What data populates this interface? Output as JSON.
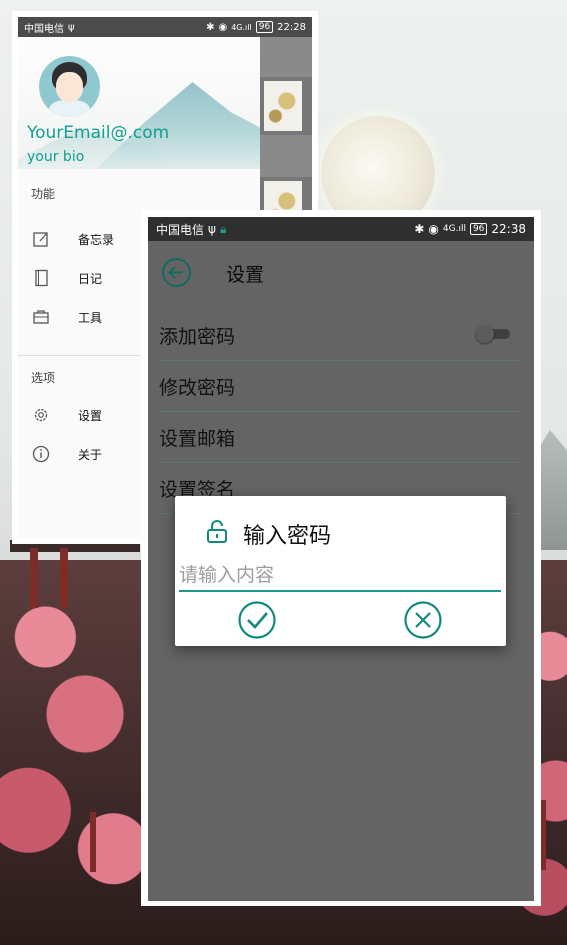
{
  "colors": {
    "accent": "#11a08f",
    "dim_overlay": "#646464",
    "dialog_bg": "#ffffff"
  },
  "drawer_screen": {
    "status": {
      "carrier": "中国电信",
      "usb": "ψ",
      "signal": "4G.ıll",
      "battery": "96",
      "time": "22:28"
    },
    "header": {
      "email": "YourEmail@.com",
      "bio": "your bio"
    },
    "groups": [
      {
        "title": "功能",
        "items": [
          {
            "label": "备忘录",
            "icon": "memo-edit-icon"
          },
          {
            "label": "日记",
            "icon": "diary-book-icon"
          },
          {
            "label": "工具",
            "icon": "toolbox-icon"
          }
        ]
      },
      {
        "title": "选项",
        "items": [
          {
            "label": "设置",
            "icon": "gear-icon"
          },
          {
            "label": "关于",
            "icon": "info-icon"
          }
        ]
      }
    ]
  },
  "settings_screen": {
    "status": {
      "carrier": "中国电信",
      "usb": "ψ",
      "signal": "4G.ıll",
      "battery": "96",
      "time": "22:38"
    },
    "title": "设置",
    "rows": [
      {
        "label": "添加密码",
        "toggle": false
      },
      {
        "label": "修改密码"
      },
      {
        "label": "设置邮箱"
      },
      {
        "label": "设置签名"
      }
    ]
  },
  "dialog": {
    "title": "输入密码",
    "icon": "unlock-icon",
    "input_placeholder": "请输入内容",
    "input_value": "",
    "confirm_icon": "check-circle-icon",
    "cancel_icon": "close-circle-icon"
  }
}
